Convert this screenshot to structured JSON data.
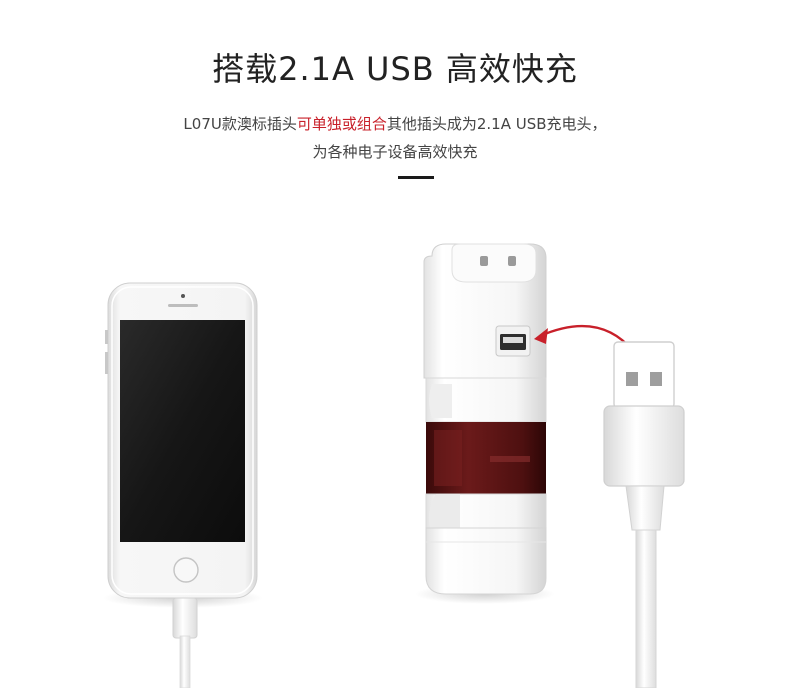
{
  "header": {
    "title": "搭载2.1A USB 高效快充",
    "desc_line1_pre": "L07U款澳标插头",
    "desc_line1_highlight": "可单独或组合",
    "desc_line1_post": "其他插头成为2.1A USB充电头，",
    "desc_line2": "为各种电子设备高效快充"
  },
  "colors": {
    "accent_red": "#c8202a",
    "adapter_band": "#5a1414",
    "phone_body": "#f4f4f4"
  },
  "icons": [
    "smartphone-icon",
    "travel-adapter-icon",
    "usb-port-icon",
    "usb-cable-icon",
    "curved-arrow-icon"
  ]
}
